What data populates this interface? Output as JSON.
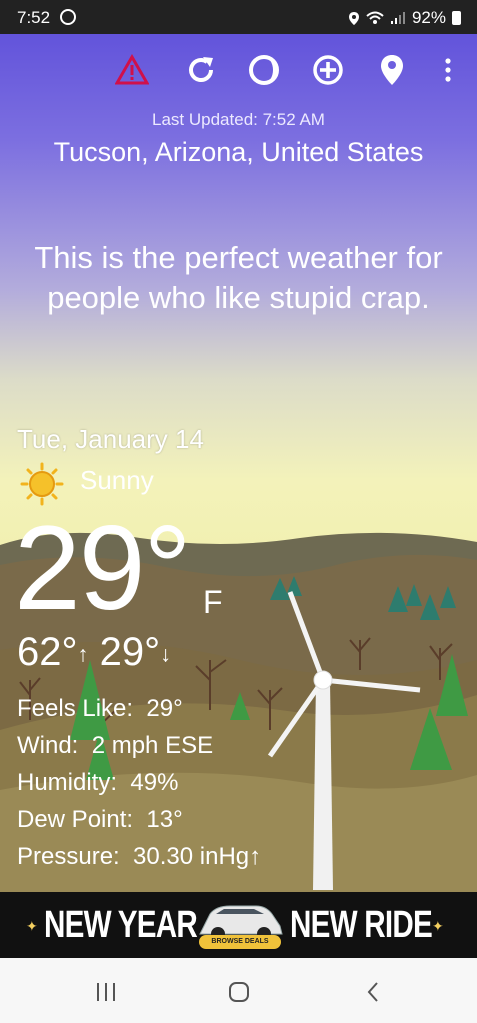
{
  "status_bar": {
    "time": "7:52",
    "battery": "92%",
    "icons": [
      "sync-icon",
      "location-icon",
      "wifi-icon",
      "signal-icon",
      "battery-icon"
    ]
  },
  "toolbar": {
    "icons": [
      "alert-icon",
      "refresh-icon",
      "moon-phase-icon",
      "add-location-icon",
      "map-pin-icon",
      "more-vert-icon"
    ],
    "alert_color": "#d0104a"
  },
  "header": {
    "last_updated": "Last Updated: 7:52 AM",
    "location": "Tucson, Arizona, United States"
  },
  "quip": "This is the perfect weather for people who like stupid crap.",
  "weather": {
    "date": "Tue, January 14",
    "condition": "Sunny",
    "temperature": "29°",
    "unit": "F",
    "high": "62°",
    "low": "29°",
    "high_arrow": "↑",
    "low_arrow": "↓",
    "details": [
      {
        "label": "Feels Like:",
        "value": "29°"
      },
      {
        "label": "Wind:",
        "value": "2 mph ESE"
      },
      {
        "label": "Humidity:",
        "value": "49%"
      },
      {
        "label": "Dew Point:",
        "value": "13°"
      },
      {
        "label": "Pressure:",
        "value": "30.30 inHg↑"
      }
    ]
  },
  "ad": {
    "left_text": "NEW YEAR",
    "right_text": "NEW RIDE",
    "button": "BROWSE DEALS"
  },
  "nav": {
    "icons": [
      "recent-apps-icon",
      "home-icon",
      "back-icon"
    ]
  }
}
